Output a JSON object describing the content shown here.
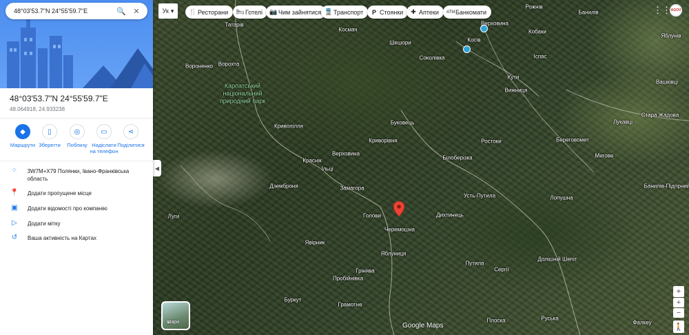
{
  "search": {
    "query": "48°03'53.7\"N 24°55'59.7\"E"
  },
  "place": {
    "title": "48°03'53.7\"N 24°55'59.7\"E",
    "decimal": "48.064918, 24.933238"
  },
  "actions": [
    {
      "label": "Маршрути",
      "icon": "directions-icon"
    },
    {
      "label": "Зберегти",
      "icon": "bookmark-icon"
    },
    {
      "label": "Поблизу",
      "icon": "nearby-icon"
    },
    {
      "label": "Надіслати на телефон",
      "icon": "send-to-phone-icon"
    },
    {
      "label": "Поділитися",
      "icon": "share-icon"
    }
  ],
  "details": [
    {
      "text": "3W7M+X79 Полянки, Івано-Франківська область",
      "icon": "plus-code-icon"
    },
    {
      "text": "Додати пропущене місце",
      "icon": "add-place-icon"
    },
    {
      "text": "Додати відомості про компанію",
      "icon": "business-icon"
    },
    {
      "text": "Додати мітку",
      "icon": "label-icon"
    },
    {
      "text": "Ваша активність на Картах",
      "icon": "history-icon"
    }
  ],
  "map": {
    "layer_toggle": "Ук",
    "chips": [
      {
        "label": "Ресторани",
        "icon": "restaurant-icon"
      },
      {
        "label": "Готелі",
        "icon": "hotel-icon"
      },
      {
        "label": "Чим зайнятися",
        "icon": "camera-icon"
      },
      {
        "label": "Транспорт",
        "icon": "transit-icon"
      },
      {
        "label": "Стоянки",
        "icon": "parking-icon"
      },
      {
        "label": "Аптеки",
        "icon": "pharmacy-icon"
      },
      {
        "label": "Банкомати",
        "icon": "atm-icon"
      }
    ],
    "layers_label": "Шари",
    "logo": "Google Maps",
    "park": "Карпатський національний природний парк",
    "places": [
      "Татарів",
      "Космач",
      "Шешори",
      "Соколівка",
      "Косів",
      "Верховина",
      "Ворохта",
      "Вороненко",
      "Криворівня",
      "Буковець",
      "Кривопілля",
      "Верховина",
      "Краснік",
      "Ільці",
      "Білоберізка",
      "Ростоки",
      "Дземброня",
      "Замагора",
      "Голови",
      "Черемошна",
      "Дихтинець",
      "Усть-Путила",
      "Луги",
      "Яблуниця",
      "Явірник",
      "Грінява",
      "Пробійнівка",
      "Путила",
      "Сергії",
      "Буркут",
      "Грамотне",
      "Плоска",
      "Руська",
      "Лопушна",
      "Долішній Шепіт",
      "Вижниця",
      "Кути",
      "Береговомет",
      "Мигове",
      "Банилів-Підгірний",
      "Лукавці",
      "Стара Жадова",
      "Вашківці",
      "Кобаки",
      "Іспас",
      "Банилів",
      "Рожнів",
      "Яблунів",
      "Фалкеу",
      "Шепіт",
      "Вижниця"
    ],
    "zoom_in": "+",
    "zoom_out": "−"
  }
}
